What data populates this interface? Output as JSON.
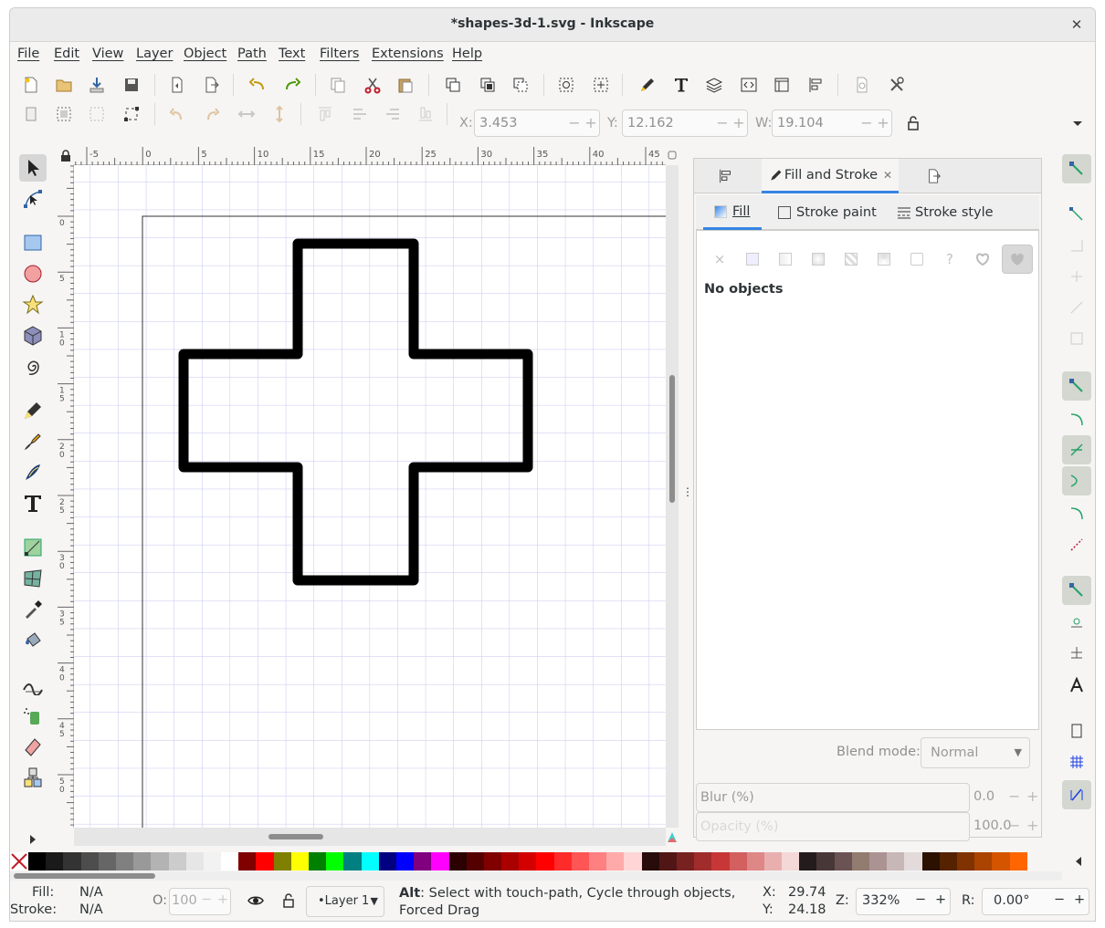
{
  "window": {
    "title": "*shapes-3d-1.svg - Inkscape",
    "close": "✕"
  },
  "menu": [
    "File",
    "Edit",
    "View",
    "Layer",
    "Object",
    "Path",
    "Text",
    "Filters",
    "Extensions",
    "Help"
  ],
  "toolbar": {
    "icons": [
      "new-document-icon",
      "open-document-icon",
      "import-icon",
      "save-icon",
      "print-icon",
      "export-icon",
      "undo-icon",
      "redo-icon",
      "copy-icon",
      "cut-icon",
      "paste-icon",
      "duplicate-icon",
      "clone-icon",
      "unlink-clone-icon",
      "zoom-selection-icon",
      "zoom-drawing-icon",
      "fill-stroke-icon",
      "text-font-icon",
      "layers-icon",
      "xml-editor-icon",
      "document-properties-icon",
      "align-distribute-icon",
      "print-preview-icon",
      "preferences-icon"
    ]
  },
  "controls": {
    "x_label": "X:",
    "x_value": "3.453",
    "y_label": "Y:",
    "y_value": "12.162",
    "w_label": "W:",
    "w_value": "19.104",
    "minus": "−",
    "plus": "+"
  },
  "ruler": {
    "h_ticks": [
      "-5",
      "0",
      "5",
      "10",
      "15",
      "20",
      "25",
      "30",
      "35",
      "40",
      "45"
    ],
    "v_ticks": [
      "0",
      "5",
      "1 0",
      "1 5",
      "2 0",
      "2 5",
      "3 0",
      "3 5",
      "4 0",
      "4 5",
      "5 0"
    ]
  },
  "panel": {
    "tab_fill_stroke": "Fill and Stroke",
    "tab_close": "✕",
    "sub_fill": "Fill",
    "sub_stroke_paint": "Stroke paint",
    "sub_stroke_style": "Stroke style",
    "no_objects": "No objects",
    "paint_unknown": "?",
    "paint_none": "×",
    "blend_label": "Blend mode:",
    "blend_value": "Normal",
    "blur_label": "Blur (%)",
    "blur_value": "0.0",
    "opacity_label": "Opacity (%)",
    "opacity_value": "100.0",
    "minus": "−",
    "plus": "+"
  },
  "palette": [
    "#000000",
    "#1a1a1a",
    "#333333",
    "#4d4d4d",
    "#666666",
    "#808080",
    "#999999",
    "#b3b3b3",
    "#cccccc",
    "#e6e6e6",
    "#f2f2f2",
    "#ffffff",
    "#800000",
    "#ff0000",
    "#808000",
    "#ffff00",
    "#008000",
    "#00ff00",
    "#008080",
    "#00ffff",
    "#000080",
    "#0000ff",
    "#800080",
    "#ff00ff",
    "#2b0000",
    "#550000",
    "#800000",
    "#aa0000",
    "#d40000",
    "#ff0000",
    "#ff2a2a",
    "#ff5555",
    "#ff8080",
    "#ffaaaa",
    "#ffd5d5",
    "#280b0b",
    "#501616",
    "#782121",
    "#a02c2c",
    "#c83737",
    "#d35f5f",
    "#de8787",
    "#e9afaf",
    "#f4d7d7",
    "#241c1c",
    "#483737",
    "#6c5353",
    "#917c6f",
    "#ac9393",
    "#c8b7b7",
    "#e3dbdb",
    "#2b1100",
    "#552200",
    "#803300",
    "#aa4400",
    "#d45500",
    "#ff6600"
  ],
  "status": {
    "fill_label": "Fill:",
    "fill_value": "N/A",
    "stroke_label": "Stroke:",
    "stroke_value": "N/A",
    "o_label": "O:",
    "o_value": "100",
    "layer": "•Layer 1",
    "hint_key": "Alt",
    "hint_text": ": Select with touch-path, Cycle through objects, Forced Drag",
    "x_label": "X:",
    "x_value": "29.74",
    "y_label": "Y:",
    "y_value": "24.18",
    "z_label": "Z:",
    "zoom": "332%",
    "r_label": "R:",
    "rotation": "0.00°",
    "minus": "−",
    "plus": "+"
  }
}
